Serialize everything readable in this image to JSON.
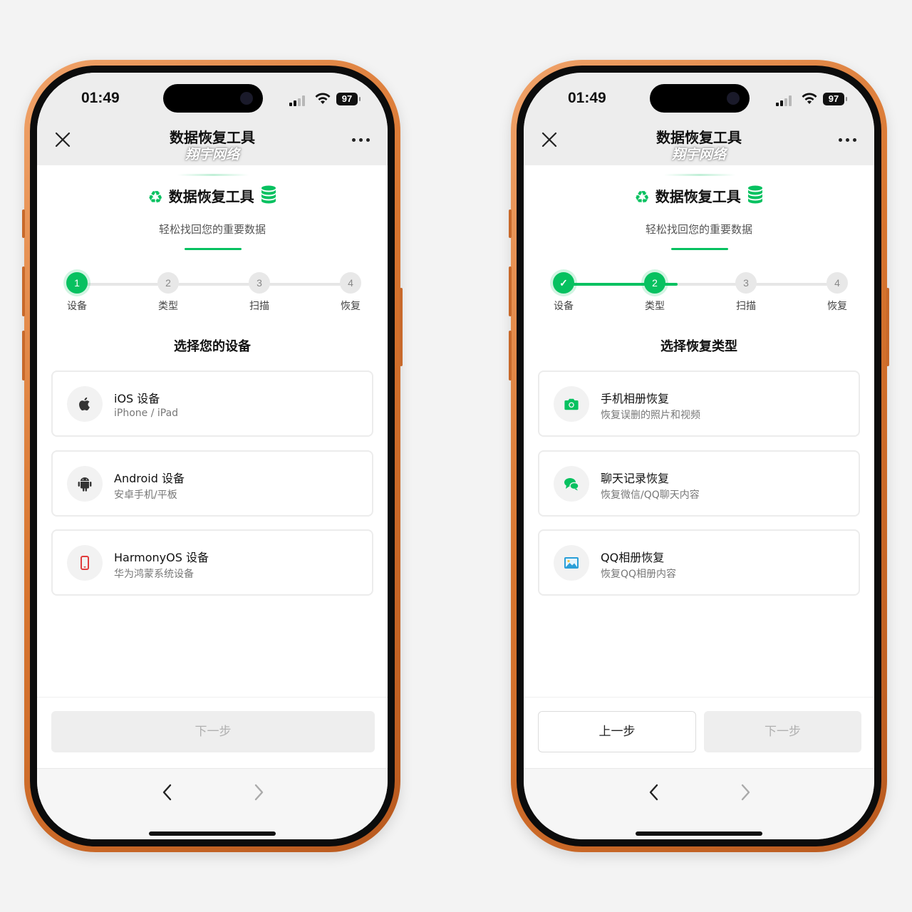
{
  "phones": [
    {
      "status": {
        "time": "01:49",
        "battery": "97"
      },
      "navbar": {
        "title": "数据恢复工具",
        "watermark": "翔宇网络"
      },
      "header": {
        "title": "数据恢复工具",
        "subtitle": "轻松找回您的重要数据"
      },
      "steps": [
        {
          "num": "1",
          "label": "设备",
          "state": "active"
        },
        {
          "num": "2",
          "label": "类型",
          "state": "pending"
        },
        {
          "num": "3",
          "label": "扫描",
          "state": "pending"
        },
        {
          "num": "4",
          "label": "恢复",
          "state": "pending"
        }
      ],
      "section_title": "选择您的设备",
      "options": [
        {
          "title": "iOS 设备",
          "desc": "iPhone / iPad",
          "icon": "apple-icon"
        },
        {
          "title": "Android 设备",
          "desc": "安卓手机/平板",
          "icon": "android-icon"
        },
        {
          "title": "HarmonyOS 设备",
          "desc": "华为鸿蒙系统设备",
          "icon": "harmony-phone-icon"
        }
      ],
      "footer": {
        "next": "下一步"
      }
    },
    {
      "status": {
        "time": "01:49",
        "battery": "97"
      },
      "navbar": {
        "title": "数据恢复工具",
        "watermark": "翔宇网络"
      },
      "header": {
        "title": "数据恢复工具",
        "subtitle": "轻松找回您的重要数据"
      },
      "steps": [
        {
          "num": "✓",
          "label": "设备",
          "state": "done"
        },
        {
          "num": "2",
          "label": "类型",
          "state": "active"
        },
        {
          "num": "3",
          "label": "扫描",
          "state": "pending"
        },
        {
          "num": "4",
          "label": "恢复",
          "state": "pending"
        }
      ],
      "section_title": "选择恢复类型",
      "options": [
        {
          "title": "手机相册恢复",
          "desc": "恢复误删的照片和视频",
          "icon": "camera-icon"
        },
        {
          "title": "聊天记录恢复",
          "desc": "恢复微信/QQ聊天内容",
          "icon": "chat-icon"
        },
        {
          "title": "QQ相册恢复",
          "desc": "恢复QQ相册内容",
          "icon": "picture-icon"
        }
      ],
      "footer": {
        "prev": "上一步",
        "next": "下一步"
      }
    }
  ],
  "colors": {
    "accent": "#07c160",
    "frame": "#d8752f"
  }
}
